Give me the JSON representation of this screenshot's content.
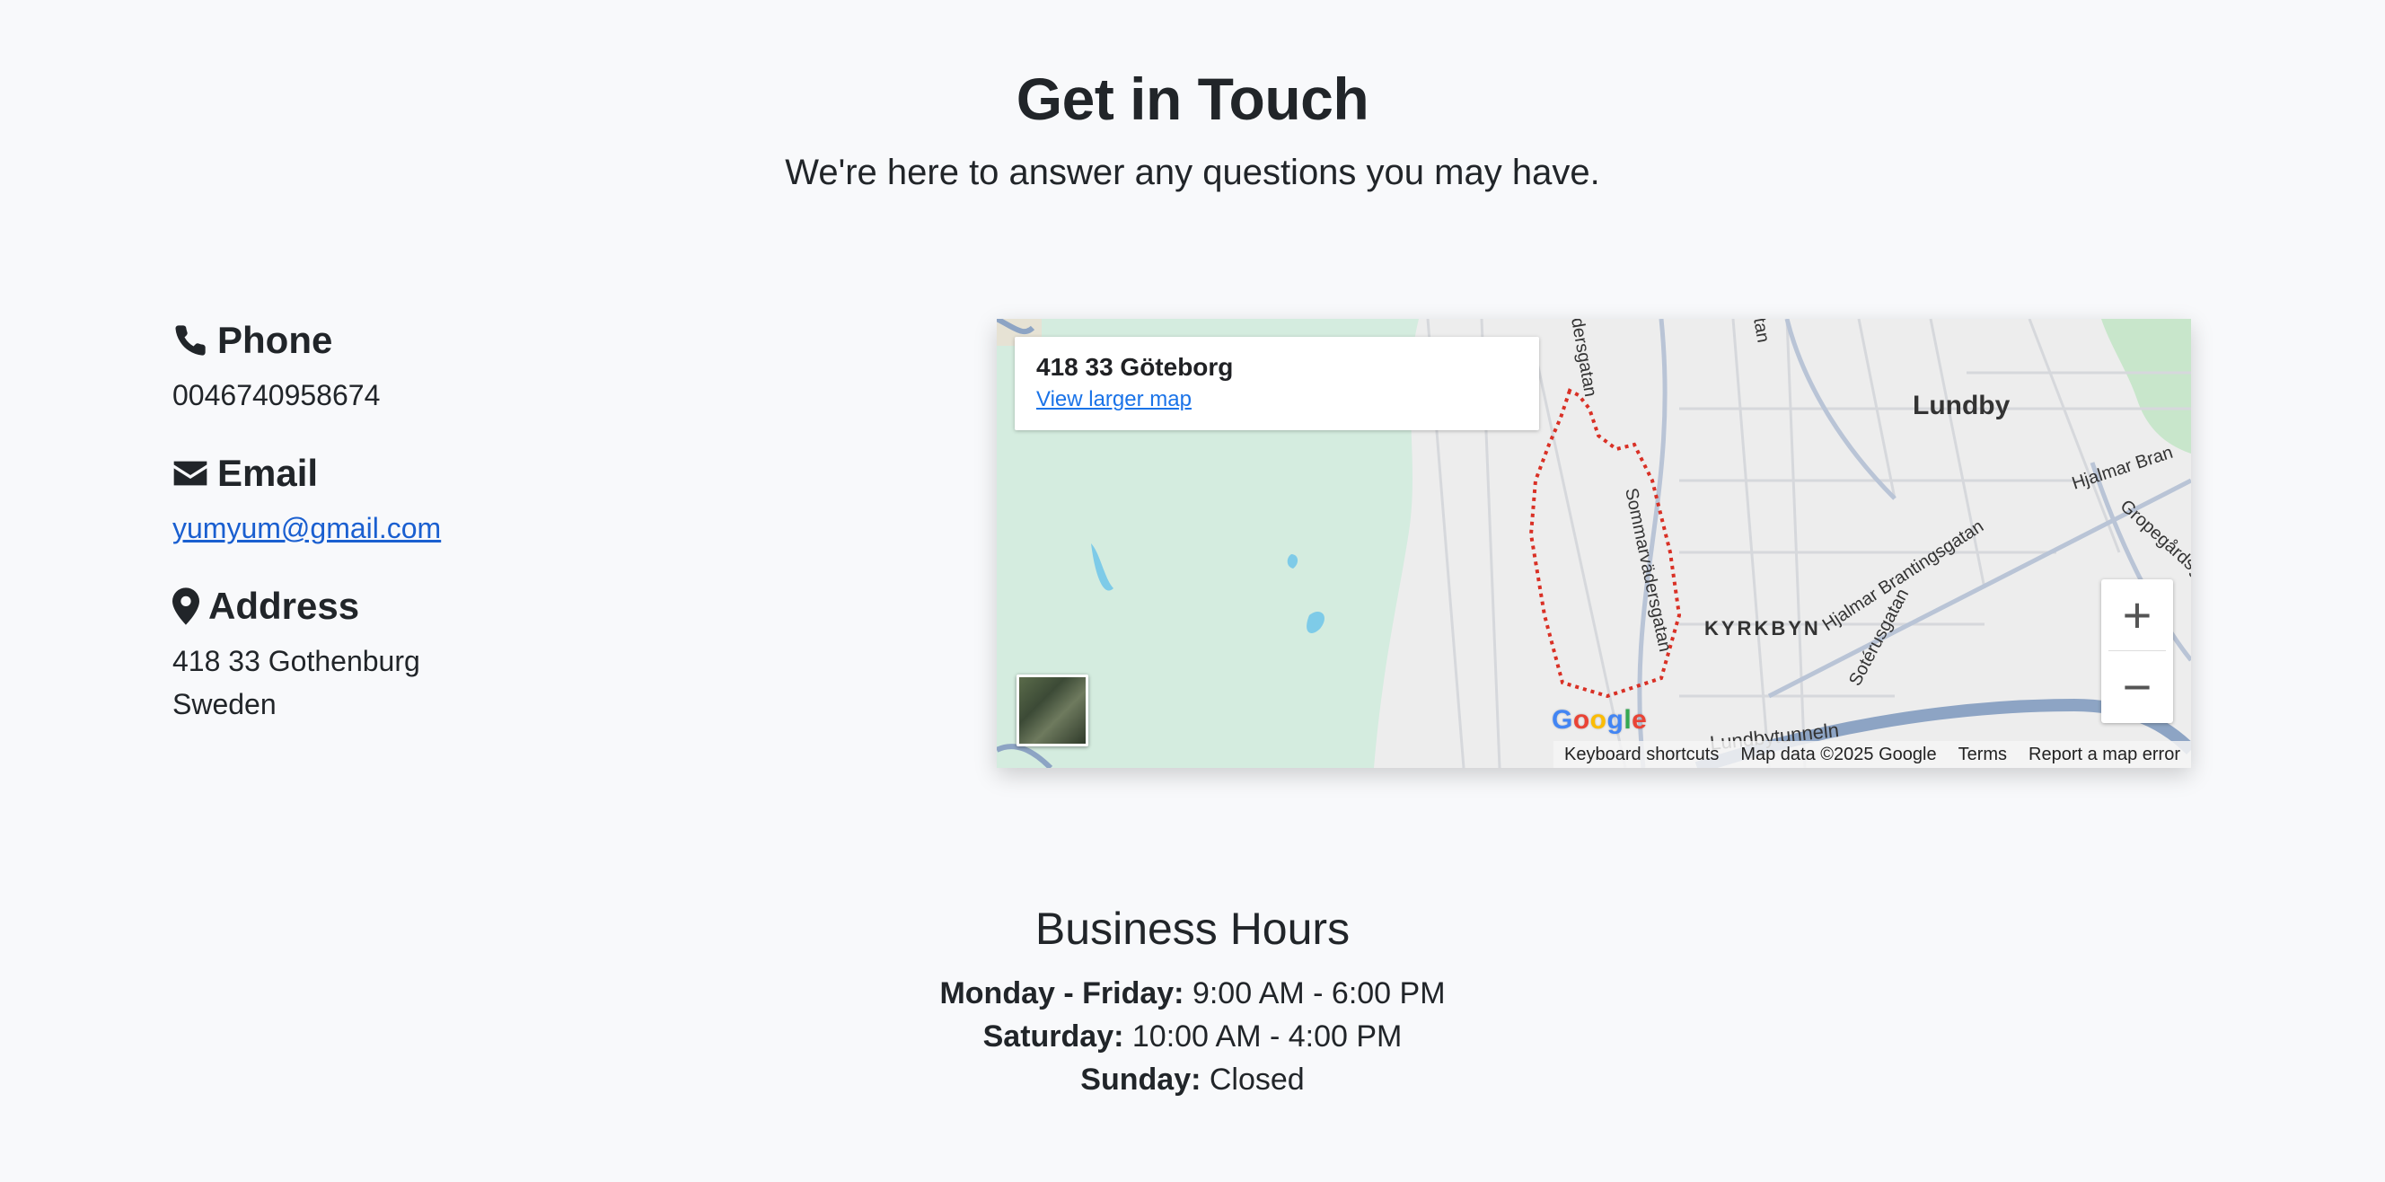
{
  "header": {
    "title": "Get in Touch",
    "subtitle": "We're here to answer any questions you may have."
  },
  "contact": {
    "phone_label": "Phone",
    "phone_value": "0046740958674",
    "email_label": "Email",
    "email_value": "yumyum@gmail.com",
    "address_label": "Address",
    "address_line1": "418 33 Gothenburg",
    "address_line2": "Sweden"
  },
  "map": {
    "place_name": "418 33 Göteborg",
    "view_larger_link": "View larger map",
    "labels": {
      "lundby": "Lundby",
      "kyrkbyn": "KYRKBYN",
      "sommarvadersgatan": "Sommarvädersgatan",
      "hjalmar_brantingsgatan": "Hjalmar Brantingsgatan",
      "hjalmar_bran": "Hjalmar Bran",
      "gropegardsg": "Gropegårdsg",
      "soterusgatan": "Sotérusgatan",
      "lundbytunneln": "Lundbytunneln",
      "dersgatan": "dersgatan",
      "tan": "tan"
    },
    "zoom_in": "+",
    "zoom_out": "−",
    "google_logo": [
      "G",
      "o",
      "o",
      "g",
      "l",
      "e"
    ],
    "attribution": {
      "keyboard_shortcuts": "Keyboard shortcuts",
      "map_data": "Map data ©2025 Google",
      "terms": "Terms",
      "report": "Report a map error"
    }
  },
  "hours": {
    "title": "Business Hours",
    "rows": [
      {
        "day": "Monday - Friday:",
        "time": " 9:00 AM - 6:00 PM"
      },
      {
        "day": "Saturday:",
        "time": " 10:00 AM - 4:00 PM"
      },
      {
        "day": "Sunday:",
        "time": " Closed"
      }
    ]
  },
  "colors": {
    "background": "#f8f9fb",
    "text": "#212529",
    "link": "#1a5fd0",
    "map_green": "#d4ecdf",
    "map_water": "#7ecbe8",
    "map_road_blue": "#8da4c4",
    "boundary_red": "#d93025"
  }
}
